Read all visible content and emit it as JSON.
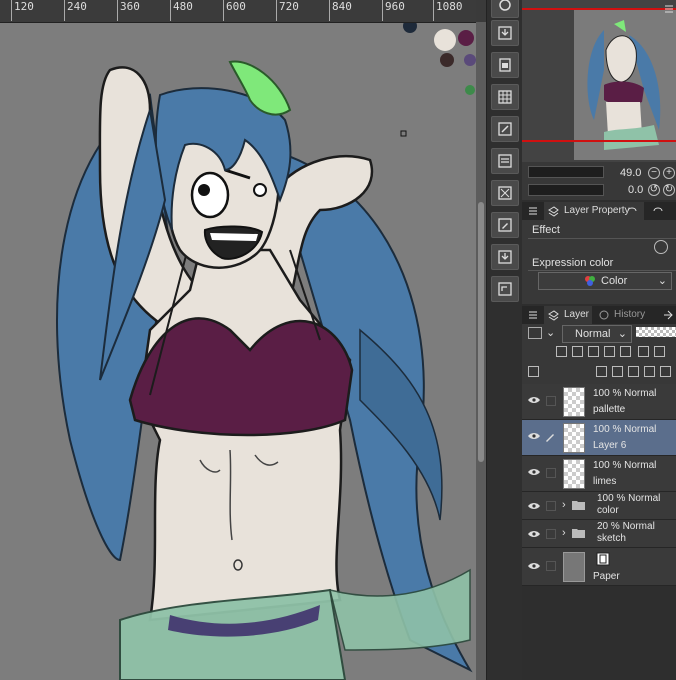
{
  "ruler": {
    "ticks": [
      "120",
      "240",
      "360",
      "480",
      "600",
      "720",
      "840",
      "960",
      "1080"
    ]
  },
  "navigator": {
    "zoom": "49.0",
    "rotation": "0.0"
  },
  "layer_property": {
    "tab_label": "Layer Property",
    "effect_label": "Effect",
    "expression_color_label": "Expression color",
    "expression_color_value": "Color"
  },
  "layer_panel": {
    "tab_layer": "Layer",
    "tab_history": "History",
    "blend_mode": "Normal",
    "layers": [
      {
        "opacity_mode": "100 % Normal",
        "name": "pallette",
        "type": "raster",
        "selected": false
      },
      {
        "opacity_mode": "100 % Normal",
        "name": "Layer 6",
        "type": "raster",
        "selected": true
      },
      {
        "opacity_mode": "100 % Normal",
        "name": "limes",
        "type": "raster",
        "selected": false
      },
      {
        "opacity_mode": "100 % Normal",
        "name": "color",
        "type": "folder",
        "selected": false
      },
      {
        "opacity_mode": "20 % Normal",
        "name": "sketch",
        "type": "folder",
        "selected": false
      },
      {
        "opacity_mode": "",
        "name": "Paper",
        "type": "paper",
        "selected": false
      }
    ]
  },
  "colors": {
    "canvas_bg": "#7d7d7d",
    "hair": "#4a7aa8",
    "skin": "#e8e2da",
    "top": "#5a1e45",
    "sarong": "#8fc2a8",
    "leaf": "#7fe87a",
    "selected_layer": "#5b6e8c",
    "navigator_frame": "#d01010"
  }
}
